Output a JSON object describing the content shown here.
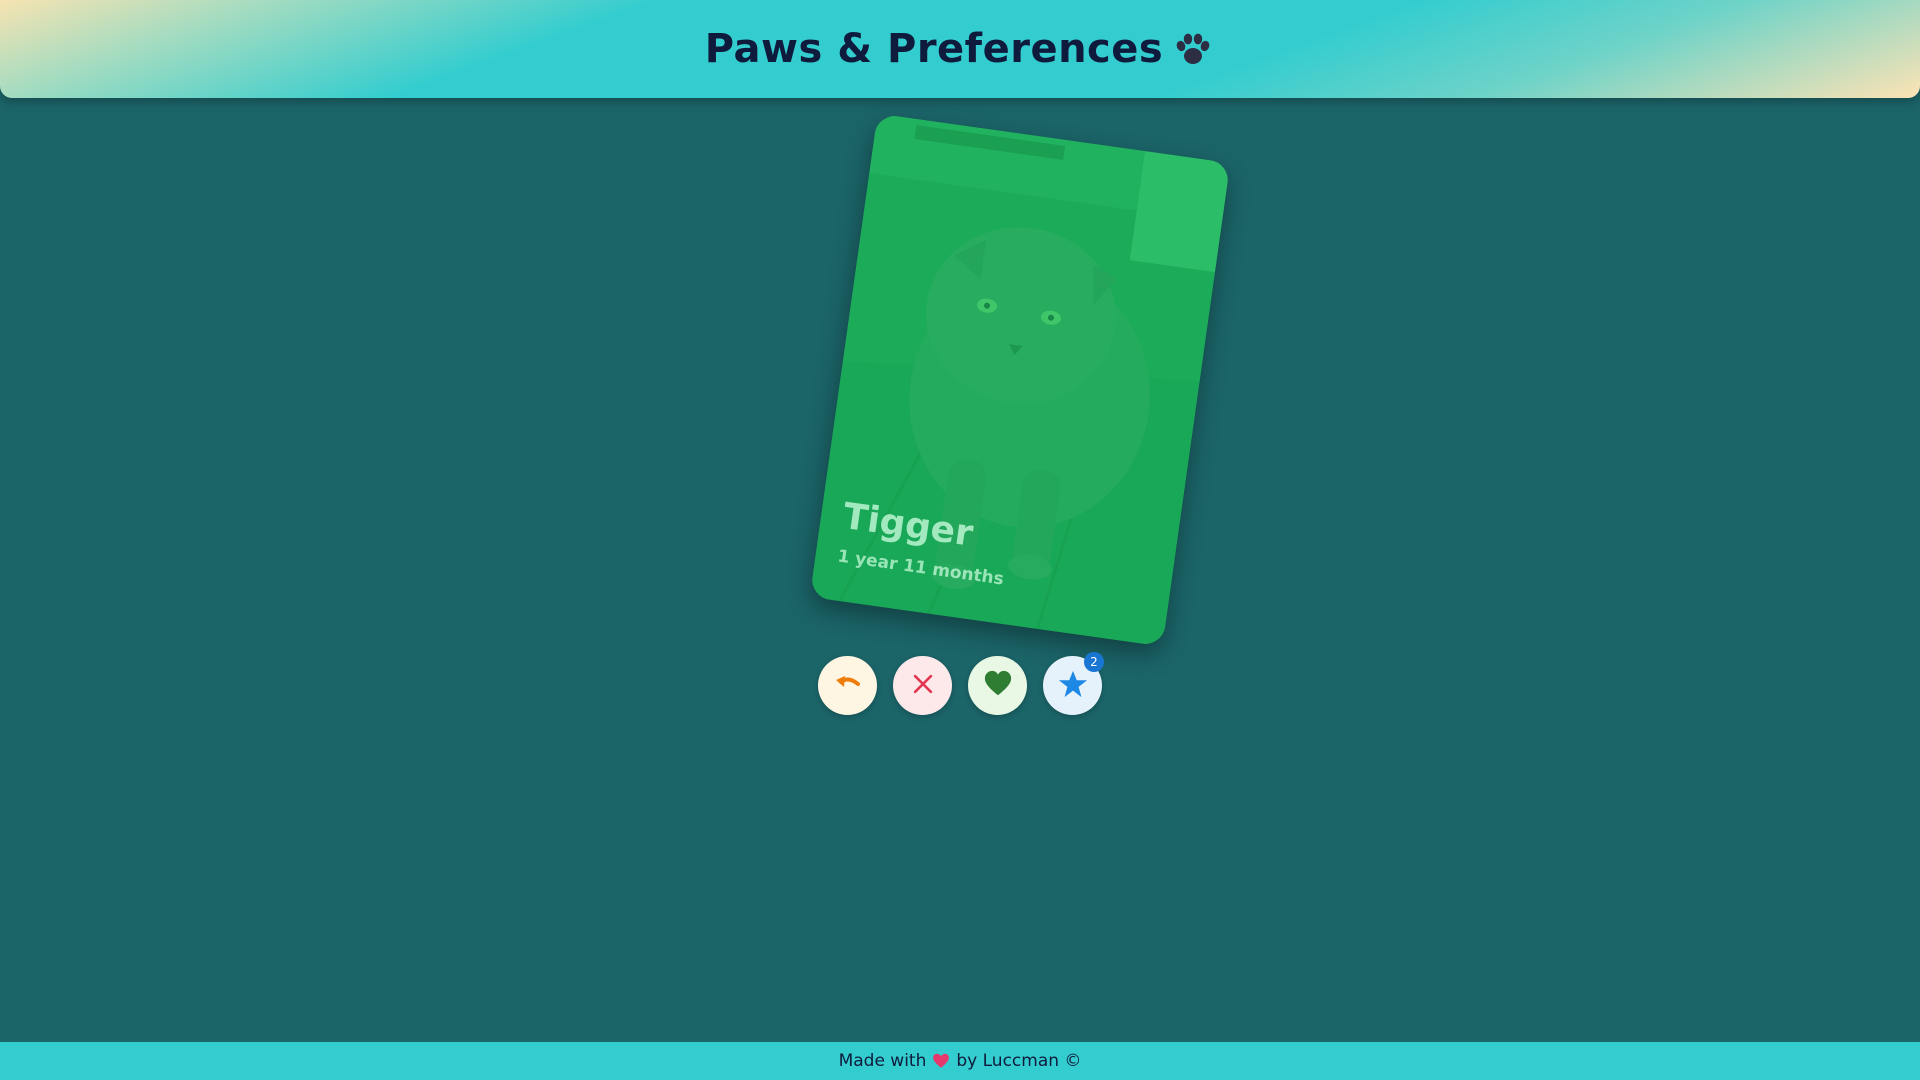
{
  "header": {
    "title": "Paws & Preferences",
    "title_icon": "paw-icon"
  },
  "card": {
    "name": "Tigger",
    "age": "1 year 11 months",
    "photo_subject": "grey cat",
    "tint_color": "#27b05c"
  },
  "actions": [
    {
      "name": "undo",
      "icon": "undo-icon",
      "color": "#ef7d0c"
    },
    {
      "name": "dislike",
      "icon": "close-icon",
      "color": "#e3344f"
    },
    {
      "name": "like",
      "icon": "heart-icon",
      "color": "#2e7d32"
    },
    {
      "name": "favorites",
      "icon": "star-icon",
      "color": "#1e88e5",
      "badge": "2"
    }
  ],
  "footer": {
    "made_with": "Made with",
    "by": "by Luccman ©",
    "heart_color": "#e7386d"
  }
}
